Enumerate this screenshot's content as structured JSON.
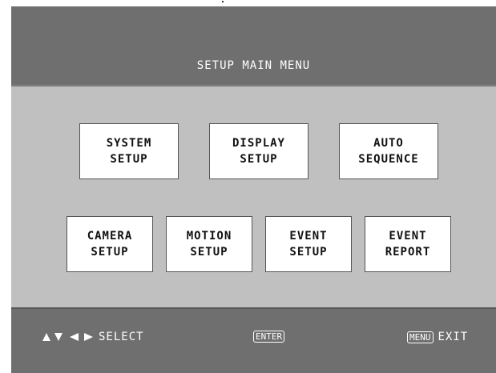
{
  "header": {
    "title": "SETUP MAIN MENU"
  },
  "menu": {
    "system_setup": {
      "line1": "SYSTEM",
      "line2": "SETUP"
    },
    "display_setup": {
      "line1": "DISPLAY",
      "line2": "SETUP"
    },
    "auto_sequence": {
      "line1": "AUTO",
      "line2": "SEQUENCE"
    },
    "camera_setup": {
      "line1": "CAMERA",
      "line2": "SETUP"
    },
    "motion_setup": {
      "line1": "MOTION",
      "line2": "SETUP"
    },
    "event_setup": {
      "line1": "EVENT",
      "line2": "SETUP"
    },
    "event_report": {
      "line1": "EVENT",
      "line2": "REPORT"
    }
  },
  "footer": {
    "select_label": "SELECT",
    "enter_key": "ENTER",
    "menu_key": "MENU",
    "exit_label": "EXIT"
  },
  "icons": {
    "up": "arrow-up-icon",
    "down": "arrow-down-icon",
    "left": "arrow-left-icon",
    "right": "arrow-right-icon"
  },
  "colors": {
    "header_bg": "#6f6f6f",
    "panel_bg": "#c0c0c0",
    "button_bg": "#ffffff",
    "text_light": "#ffffff"
  }
}
